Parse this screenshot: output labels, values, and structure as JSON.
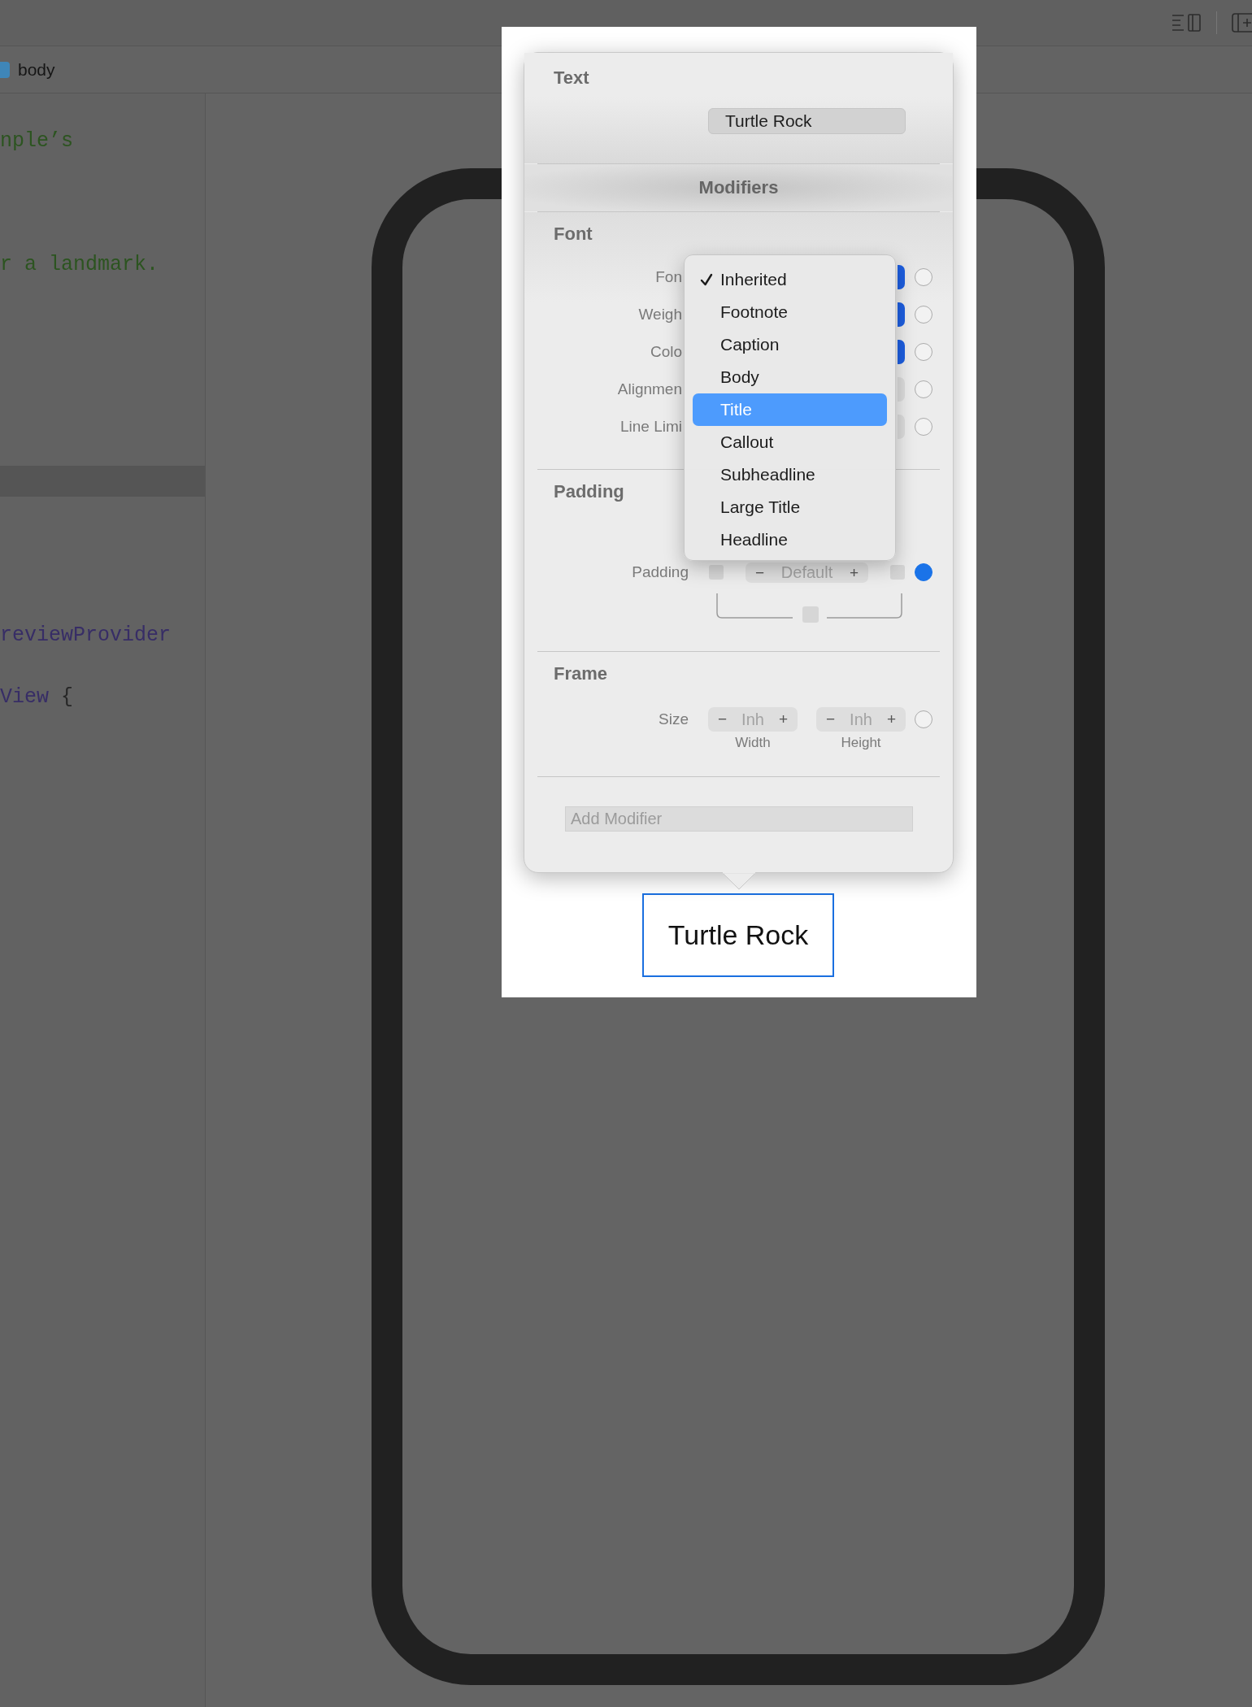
{
  "breadcrumb": {
    "label": "body"
  },
  "code_lines": [
    {
      "tokens": [
        {
          "text": "nple’s",
          "kind": "comment"
        }
      ]
    },
    {
      "tokens": [
        {
          "text": "r a landmark.",
          "kind": "comment"
        }
      ]
    },
    {
      "tokens": [
        {
          "text": "reviewProvider",
          "kind": "type"
        }
      ]
    },
    {
      "tokens": [
        {
          "text": "View",
          "kind": "type"
        },
        {
          "text": " {",
          "kind": "plain"
        }
      ]
    }
  ],
  "inspector": {
    "title": "Text",
    "text_value": "Turtle Rock",
    "modifiers_label": "Modifiers",
    "font": {
      "title": "Font",
      "rows": [
        {
          "label": "Fon",
          "active": true,
          "on": false
        },
        {
          "label": "Weigh",
          "active": true,
          "on": false
        },
        {
          "label": "Colo",
          "active": true,
          "on": false
        },
        {
          "label": "Alignmen",
          "active": false,
          "on": false
        },
        {
          "label": "Line Limi",
          "active": false,
          "on": false
        }
      ]
    },
    "padding": {
      "title": "Padding",
      "label": "Padding",
      "edges": [
        {
          "checked": false
        },
        {
          "checked": false
        },
        {
          "checked": false
        }
      ],
      "decrement": "−",
      "value": "Default",
      "increment": "+",
      "on": true
    },
    "frame": {
      "title": "Frame",
      "label": "Size",
      "on": false,
      "fields": [
        {
          "decrement": "−",
          "value": "Inh",
          "increment": "+",
          "caption": "Width"
        },
        {
          "decrement": "−",
          "value": "Inh",
          "increment": "+",
          "caption": "Height"
        }
      ]
    },
    "add_modifier": {
      "placeholder": "Add Modifier"
    }
  },
  "font_menu": {
    "items": [
      {
        "label": "Inherited",
        "checked": true,
        "selected": false
      },
      {
        "label": "Footnote",
        "checked": false,
        "selected": false
      },
      {
        "label": "Caption",
        "checked": false,
        "selected": false
      },
      {
        "label": "Body",
        "checked": false,
        "selected": false
      },
      {
        "label": "Title",
        "checked": false,
        "selected": true
      },
      {
        "label": "Callout",
        "checked": false,
        "selected": false
      },
      {
        "label": "Subheadline",
        "checked": false,
        "selected": false
      },
      {
        "label": "Large Title",
        "checked": false,
        "selected": false
      },
      {
        "label": "Headline",
        "checked": false,
        "selected": false
      }
    ]
  },
  "preview": {
    "label": "Turtle Rock",
    "selected": true
  }
}
